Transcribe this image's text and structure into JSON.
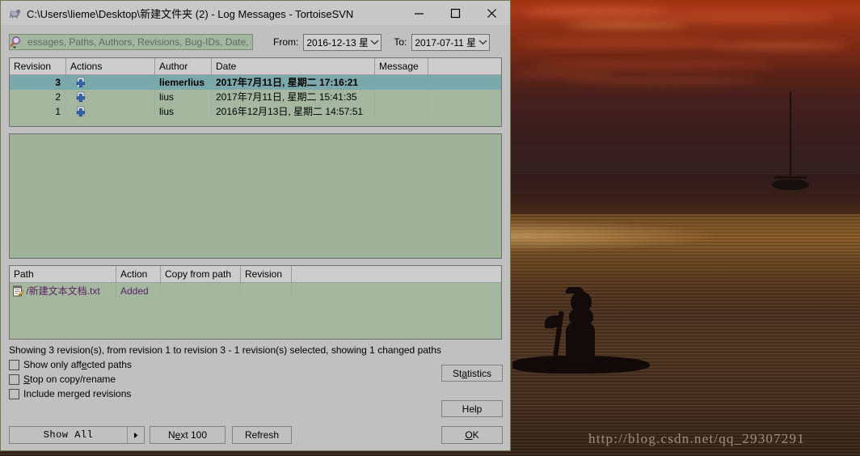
{
  "window": {
    "title": "C:\\Users\\lieme\\Desktop\\新建文件夹 (2) - Log Messages - TortoiseSVN",
    "app_icon": "tortoise-svn-icon",
    "minimize_label": "—",
    "maximize_label": "□",
    "close_label": "✕"
  },
  "toolbar": {
    "search_icon": "search-icon",
    "search_value": "",
    "search_placeholder": "essages, Paths, Authors, Revisions, Bug-IDs, Date,",
    "from_label": "From:",
    "from_value": "2016-12-13 星:",
    "to_label": "To:",
    "to_value": "2017-07-11 星:"
  },
  "revision_table": {
    "columns": [
      "Revision",
      "Actions",
      "Author",
      "Date",
      "Message",
      ""
    ],
    "rows": [
      {
        "revision": "3",
        "action_icon": "added-icon",
        "author": "liemerlius",
        "date": "2017年7月11日, 星期二 17:16:21",
        "message": "",
        "selected": true
      },
      {
        "revision": "2",
        "action_icon": "added-icon",
        "author": "lius",
        "date": "2017年7月11日, 星期二 15:41:35",
        "message": "",
        "selected": false
      },
      {
        "revision": "1",
        "action_icon": "added-icon",
        "author": "lius",
        "date": "2016年12月13日, 星期二 14:57:51",
        "message": "",
        "selected": false
      }
    ]
  },
  "message_pane": {
    "text": ""
  },
  "path_table": {
    "columns": [
      "Path",
      "Action",
      "Copy from path",
      "Revision",
      ""
    ],
    "rows": [
      {
        "file_icon": "text-document-icon",
        "path": "/新建文本文档.txt",
        "action": "Added",
        "copy_from_path": "",
        "revision": ""
      }
    ]
  },
  "status": {
    "text": "Showing 3 revision(s), from revision 1 to revision 3 - 1 revision(s) selected, showing 1 changed paths"
  },
  "options": [
    {
      "label_pre": "Show only aff",
      "label_mn": "e",
      "label_post": "cted paths",
      "checked": false,
      "name": "show-only-affected-paths"
    },
    {
      "label_pre": "",
      "label_mn": "S",
      "label_post": "top on copy/rename",
      "checked": false,
      "name": "stop-on-copy-rename"
    },
    {
      "label_pre": "Include merged revisions",
      "label_mn": "",
      "label_post": "",
      "checked": false,
      "name": "include-merged-revisions"
    }
  ],
  "buttons": {
    "show_all": "Show All",
    "show_all_dropdown": "▶",
    "next_100_pre": "N",
    "next_100_mn": "e",
    "next_100_post": "xt 100",
    "refresh": "Refresh",
    "statistics_pre": "St",
    "statistics_mn": "a",
    "statistics_post": "tistics",
    "help": "Help",
    "ok_pre": "",
    "ok_mn": "O",
    "ok_post": "K"
  },
  "background": {
    "watermark": "http://blog.csdn.net/qq_29307291",
    "scene": "sunset-seascape-with-kayaker"
  },
  "colors": {
    "window_chrome": "#c0c0c0",
    "grid_background": "#a4b89f",
    "selection": "#7ba8ab",
    "message_pane": "#9fb29a",
    "sky": "#9e3311",
    "water": "#7d5526"
  }
}
